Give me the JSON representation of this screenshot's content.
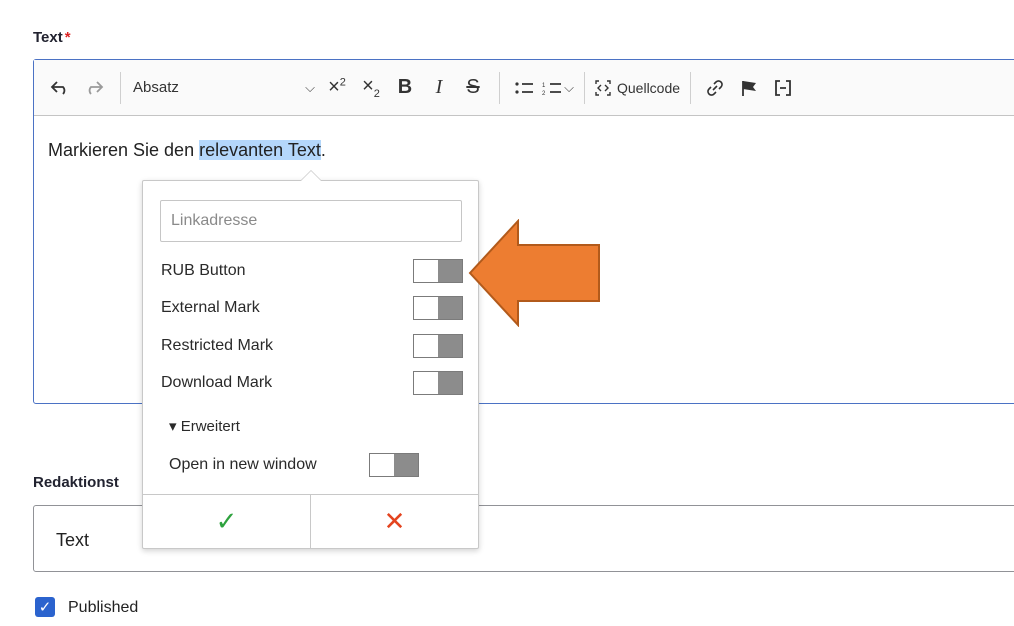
{
  "text_field": {
    "label": "Text",
    "required_mark": "*"
  },
  "toolbar": {
    "undo_icon": "undo-icon",
    "redo_icon": "redo-icon",
    "heading_select": "Absatz",
    "source_label": "Quellcode"
  },
  "editor": {
    "before": "Markieren Sie den ",
    "highlighted": "relevanten Text",
    "after": "."
  },
  "link_balloon": {
    "placeholder": "Linkadresse",
    "options": [
      {
        "label": "RUB Button",
        "on": false
      },
      {
        "label": "External Mark",
        "on": false
      },
      {
        "label": "Restricted Mark",
        "on": false
      },
      {
        "label": "Download Mark",
        "on": false
      }
    ],
    "advanced": {
      "header": "▾ Erweitert",
      "open_new_window": "Open in new window",
      "open_new_window_on": false
    },
    "save_glyph": "✓",
    "cancel_glyph": "✕"
  },
  "status_field": {
    "label": "Redaktionst",
    "value": "Text"
  },
  "published": {
    "label": "Published",
    "checked": true
  },
  "colors": {
    "arrow_fill": "#ed7d31",
    "arrow_stroke": "#b25a1b",
    "focus_border": "#4b72c4",
    "highlight": "#b4d7fb",
    "checkbox": "#2b63ce"
  }
}
